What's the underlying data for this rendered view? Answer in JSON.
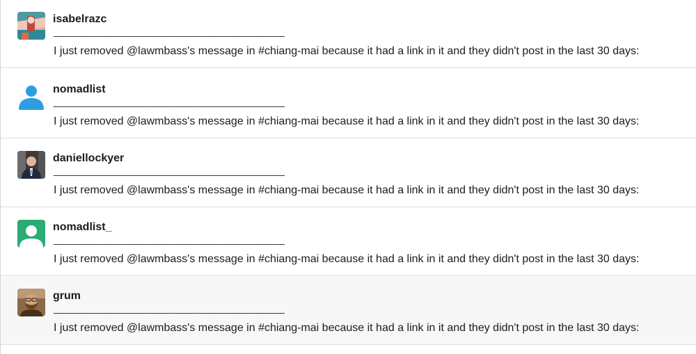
{
  "messages": [
    {
      "username": "isabelrazc",
      "avatar": "avatar-photo-colorful",
      "separator": "______________________________________",
      "text": "I just removed @lawmbass's message in #chiang-mai because it had a link in it and they didn't post in the last 30 days:"
    },
    {
      "username": "nomadlist",
      "avatar": "default-user-icon-blue",
      "separator": "______________________________________",
      "text": "I just removed @lawmbass's message in #chiang-mai because it had a link in it and they didn't post in the last 30 days:"
    },
    {
      "username": "daniellockyer",
      "avatar": "avatar-photo-man-suit",
      "separator": "______________________________________",
      "text": "I just removed @lawmbass's message in #chiang-mai because it had a link in it and they didn't post in the last 30 days:"
    },
    {
      "username": "nomadlist_",
      "avatar": "default-user-icon-green",
      "separator": "______________________________________",
      "text": "I just removed @lawmbass's message in #chiang-mai because it had a link in it and they didn't post in the last 30 days:"
    },
    {
      "username": "grum",
      "avatar": "avatar-photo-bearded-man",
      "separator": "______________________________________",
      "text": "I just removed @lawmbass's message in #chiang-mai because it had a link in it and they didn't post in the last 30 days:"
    }
  ],
  "colors": {
    "blue_avatar": "#2d9ee0",
    "green_avatar": "#2bac76",
    "hover_row": "#f7f7f7"
  }
}
